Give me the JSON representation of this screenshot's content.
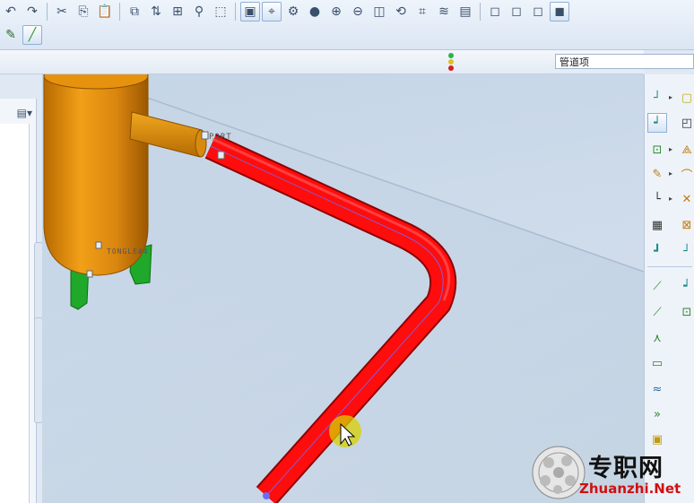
{
  "toolbar": {
    "row1": [
      {
        "name": "undo-icon",
        "glyph": "↶"
      },
      {
        "name": "redo-icon",
        "glyph": "↷"
      },
      {
        "name": "cut-icon",
        "glyph": "✂"
      },
      {
        "name": "copy-icon",
        "glyph": "⎘"
      },
      {
        "name": "paste-icon",
        "glyph": "📋"
      },
      {
        "name": "paste-special-icon",
        "glyph": "⧉"
      },
      {
        "name": "regenerate-icon",
        "glyph": "⇅"
      },
      {
        "name": "model-tree-icon",
        "glyph": "⊞"
      },
      {
        "name": "find-icon",
        "glyph": "⚲"
      },
      {
        "name": "select-box-icon",
        "glyph": "⬚"
      },
      {
        "name": "refit-icon",
        "glyph": "▣"
      },
      {
        "name": "datum-display-icon",
        "glyph": "⌖"
      },
      {
        "name": "view-manager-icon",
        "glyph": "⚙"
      },
      {
        "name": "appearance-sphere-icon",
        "glyph": "●"
      },
      {
        "name": "zoom-in-icon",
        "glyph": "⊕"
      },
      {
        "name": "zoom-out-icon",
        "glyph": "⊖"
      },
      {
        "name": "zoom-fit-icon",
        "glyph": "◫"
      },
      {
        "name": "orient-icon",
        "glyph": "⟲"
      },
      {
        "name": "saved-views-icon",
        "glyph": "⌗"
      },
      {
        "name": "layers-icon",
        "glyph": "≋"
      },
      {
        "name": "repaint-icon",
        "glyph": "▤"
      },
      {
        "name": "wireframe-icon",
        "glyph": "◻"
      },
      {
        "name": "hidden-line-icon",
        "glyph": "◻"
      },
      {
        "name": "no-hidden-icon",
        "glyph": "◻"
      },
      {
        "name": "shading-icon",
        "glyph": "◼"
      }
    ],
    "row2": [
      {
        "name": "sketch-tool-icon",
        "glyph": "✎"
      },
      {
        "name": "pipe-route-icon",
        "glyph": "╱"
      }
    ]
  },
  "subbar": {
    "filter_value": "管道项",
    "status_colors": [
      "#2bb34a",
      "#e0c020",
      "#d02020"
    ]
  },
  "model": {
    "port_label": "PORT",
    "tank_label": "TONGLE#4"
  },
  "colors": {
    "pipe": "#ff0d0d",
    "tank": "#e8910c",
    "support": "#1fa82a",
    "viewport_bg": "#cbd9e8"
  },
  "right_tools": [
    "route-pipe-icon",
    "insert-fitting-icon",
    "add-component-icon",
    "draw-line-icon",
    "corner-icon",
    "grid-icon",
    "pipeline-icon",
    "spec-icon",
    "flex-pipe-icon",
    "branch-icon",
    "sheet-icon",
    "bend-icon",
    "jump-icon",
    "folder-icon",
    "yellow-box-icon",
    "fit-icon",
    "triangle-icon",
    "arc-icon",
    "cross-icon",
    "connector-icon"
  ],
  "watermark": {
    "cn_text": "专职网",
    "en_text": "Zhuanzhi.Net"
  }
}
